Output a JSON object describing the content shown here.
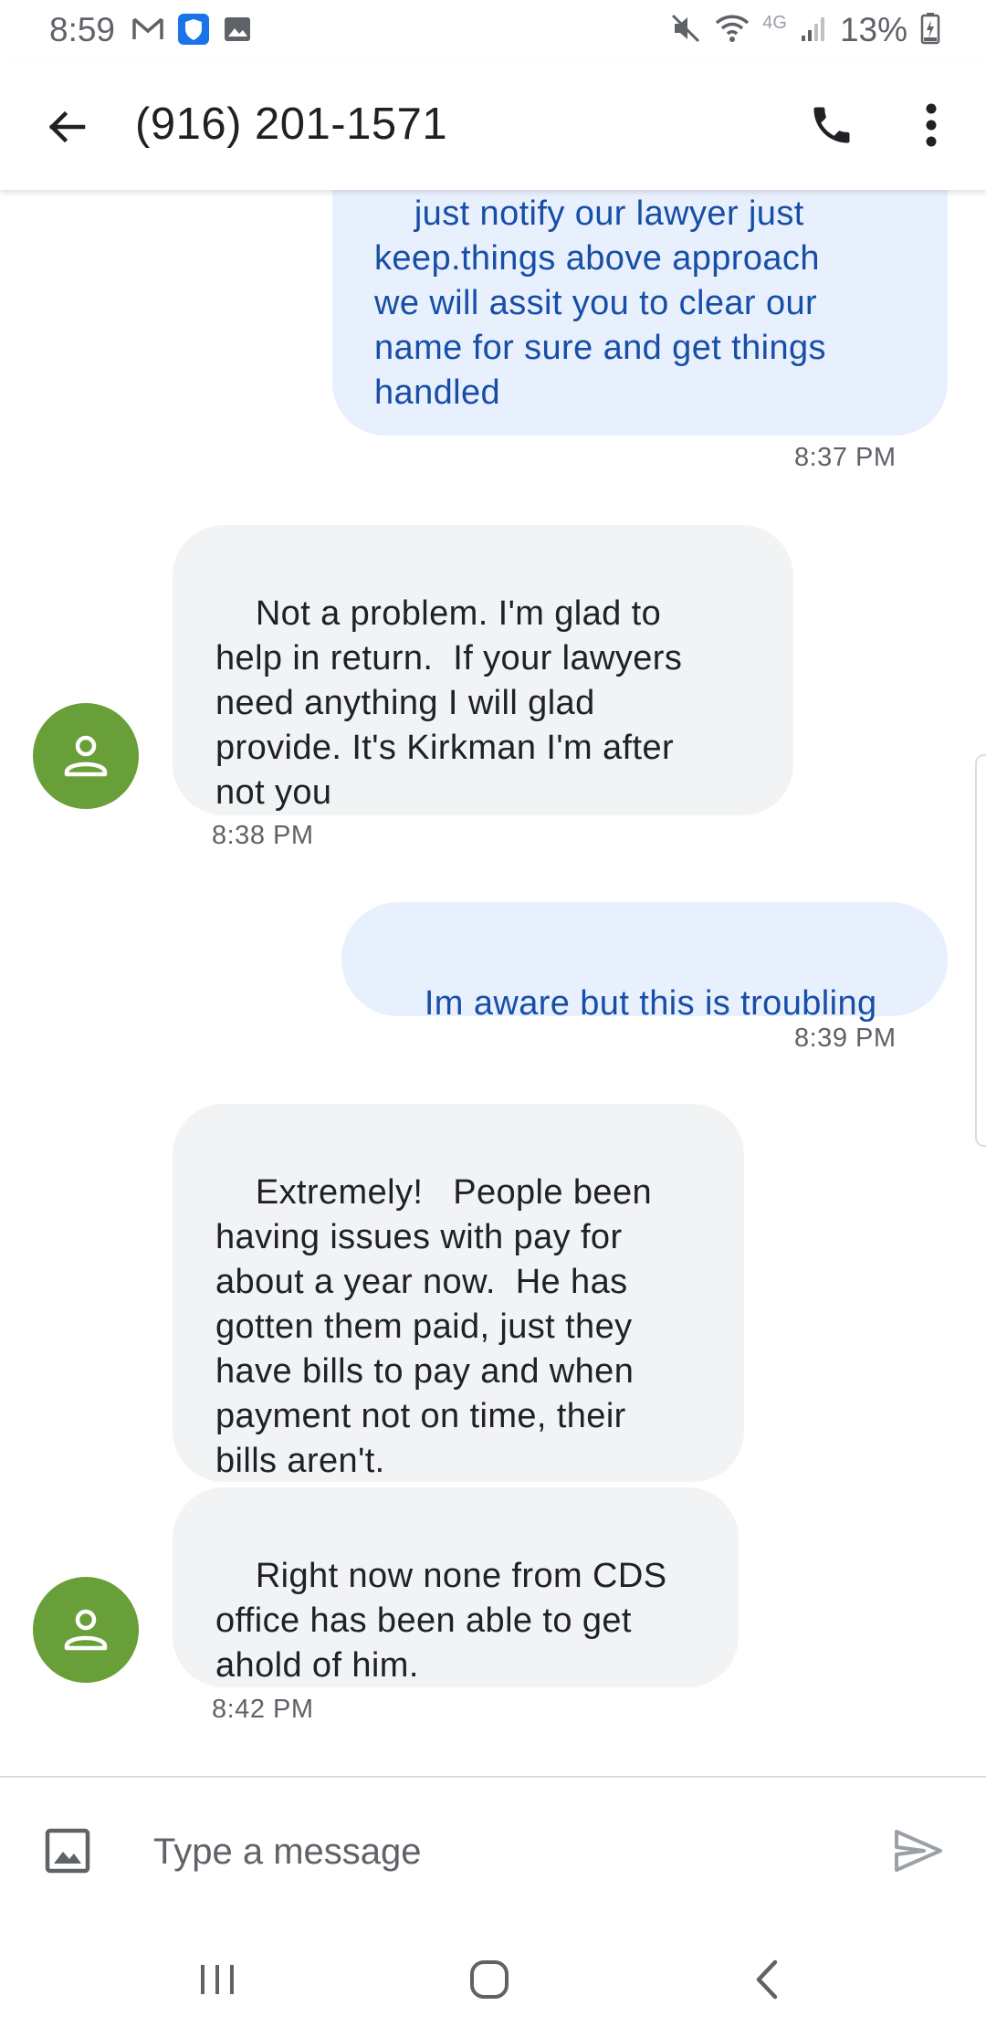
{
  "status_bar": {
    "time": "8:59",
    "network": "4G",
    "battery": "13%"
  },
  "header": {
    "title": "(916) 201-1571",
    "icons": [
      "back-arrow-icon",
      "phone-icon",
      "more-vert-icon"
    ]
  },
  "messages": [
    {
      "direction": "outgoing",
      "text": "just notify our lawyer just\nkeep.things above approach\nwe will assit you to clear our\nname for sure and get things\nhandled",
      "time": "8:37 PM"
    },
    {
      "direction": "incoming",
      "text": "Not a problem. I'm glad to\nhelp in return.  If your lawyers\nneed anything I will glad\nprovide. It's Kirkman I'm after\nnot you",
      "time": "8:38 PM"
    },
    {
      "direction": "outgoing",
      "text": "Im aware but this is troubling",
      "time": "8:39 PM"
    },
    {
      "direction": "incoming",
      "text": "Extremely!   People been\nhaving issues with pay for\nabout a year now.  He has\ngotten them paid, just they\nhave bills to pay and when\npayment not on time, their\nbills aren't.",
      "time": ""
    },
    {
      "direction": "incoming",
      "text": "Right now none from CDS\noffice has been able to get\nahold of him.",
      "time": "8:42 PM"
    }
  ],
  "compose": {
    "placeholder": "Type a message"
  },
  "colors": {
    "outgoing_bubble": "#e8f0fe",
    "outgoing_text": "#174ea6",
    "incoming_bubble": "#f1f3f4",
    "avatar": "#689f38"
  }
}
